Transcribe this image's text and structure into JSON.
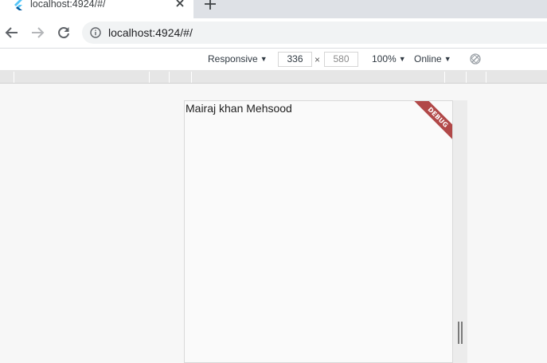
{
  "browser": {
    "tab": {
      "title": "localhost:4924/#/",
      "favicon": "flutter-logo-icon",
      "close_icon": "close-icon"
    },
    "new_tab_icon": "plus-icon",
    "nav": {
      "back_icon": "arrow-left-icon",
      "forward_icon": "arrow-right-icon",
      "reload_icon": "reload-icon"
    },
    "address_bar": {
      "info_icon": "info-icon",
      "url": "localhost:4924/#/"
    }
  },
  "device_toolbar": {
    "device_mode": "Responsive",
    "width": "336",
    "separator": "×",
    "height": "580",
    "zoom": "100%",
    "throttling": "Online",
    "rotate_icon": "rotate-disabled-icon"
  },
  "app": {
    "text": "Mairaj khan Mehsood",
    "debug_banner": "DEBUG"
  },
  "colors": {
    "tab_strip": "#dee1e6",
    "omnibox": "#f1f3f4",
    "debug_banner": "#a32828",
    "flutter_light": "#54c5f8",
    "flutter_dark": "#01579b"
  }
}
